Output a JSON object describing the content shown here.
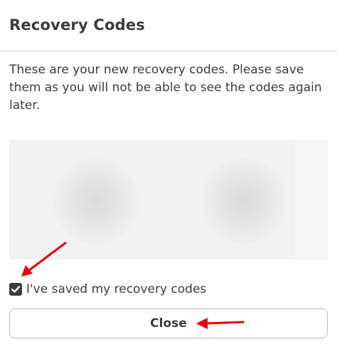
{
  "dialog": {
    "title": "Recovery Codes",
    "description": "These are your new recovery codes. Please save them as you will not be able to see the codes again later."
  },
  "codes_panel": {
    "state": "blurred"
  },
  "confirm_checkbox": {
    "label": "I've saved my recovery codes",
    "checked": true,
    "icon": "checkmark-icon"
  },
  "close_button": {
    "label": "Close"
  },
  "annotations": {
    "arrow_color": "#e60000",
    "arrows": [
      "arrow-to-checkbox",
      "arrow-to-close-button"
    ]
  },
  "colors": {
    "text": "#393b3d",
    "divider": "#d6d6d6",
    "codes_background": "#f2f2f2",
    "button_border": "#b8b8b8"
  }
}
